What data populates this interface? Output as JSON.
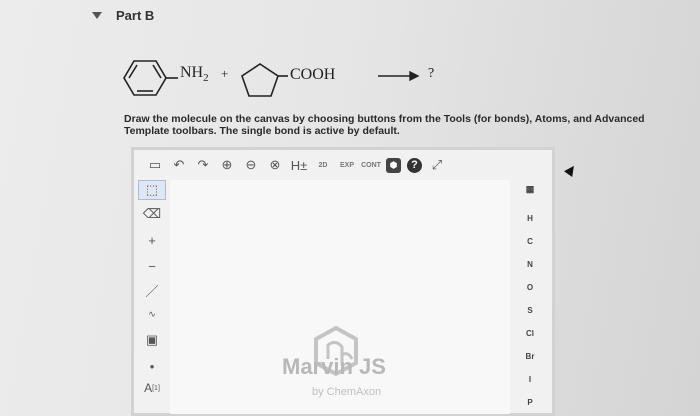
{
  "part": {
    "title": "Part B"
  },
  "reaction": {
    "reactant1_group": "NH",
    "reactant1_sub": "2",
    "plus": "+",
    "reactant2_group": "COOH",
    "product": "?"
  },
  "instructions": "Draw the molecule on the canvas by choosing buttons from the Tools (for bonds), Atoms, and Advanced Template toolbars. The single bond is active by default.",
  "toolbar": {
    "hydrogen_label": "H±",
    "label_2d": "2D",
    "label_exp": "EXP",
    "label_cont": "CONT",
    "help": "?"
  },
  "left_tools": {
    "plus": "+",
    "minus": "−",
    "atom_label": "A",
    "atom_sup": "[1]"
  },
  "atoms": [
    "H",
    "C",
    "N",
    "O",
    "S",
    "Cl",
    "Br",
    "I",
    "P"
  ],
  "logo": {
    "name": "Marvin JS",
    "sub": "by ChemAxon"
  },
  "colors": {
    "editor_bg": "#f1f1f1",
    "canvas_bg": "#f8f8f8",
    "logo": "#b8b8b8"
  }
}
